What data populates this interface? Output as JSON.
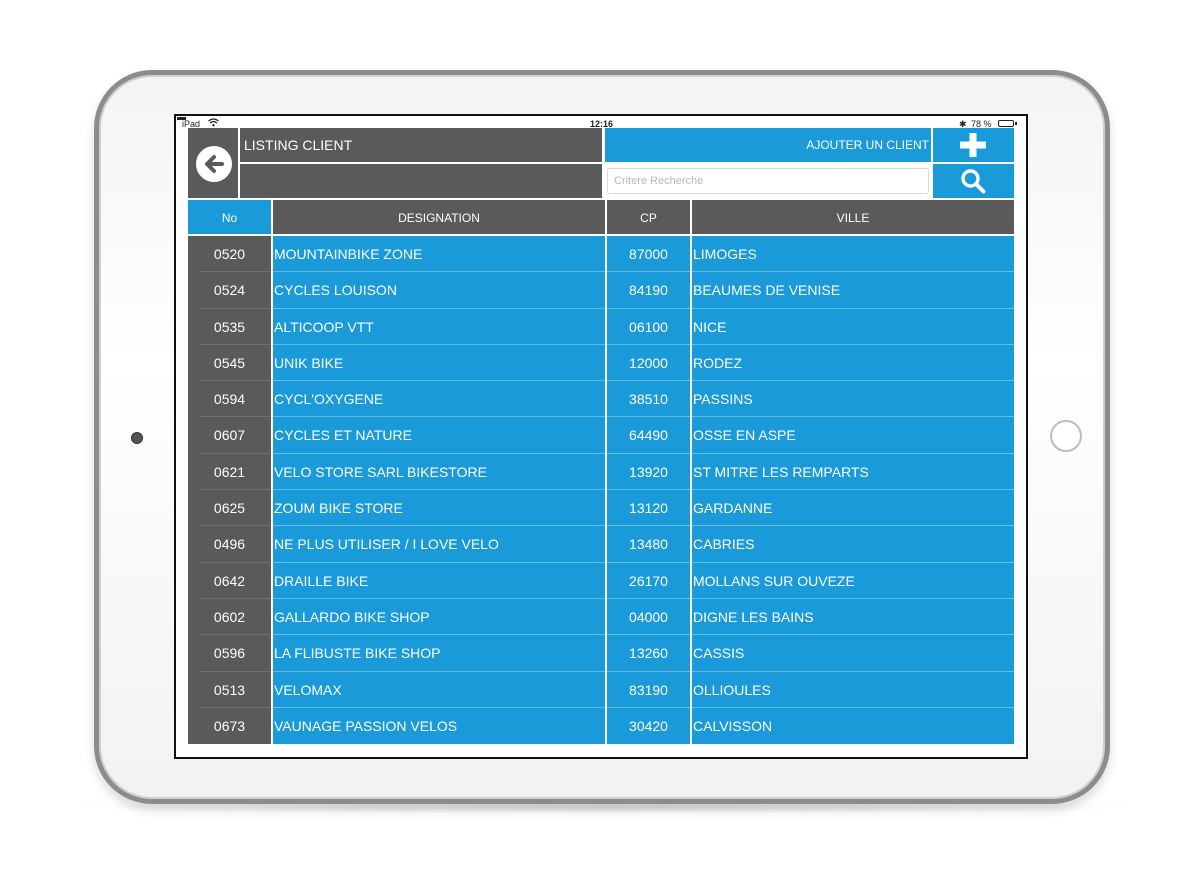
{
  "device": {
    "name": "iPad",
    "time": "12:16",
    "battery_text": "78 %",
    "battery_level": 0.78
  },
  "header": {
    "title": "LISTING CLIENT",
    "subtitle": "",
    "add_client_label": "AJOUTER UN CLIENT",
    "search_placeholder": "Critere Recherche",
    "search_value": ""
  },
  "icons": {
    "back": "arrow-left-circle-icon",
    "add": "plus-icon",
    "search": "magnifier-icon"
  },
  "colors": {
    "dark": "#5a5a5a",
    "accent": "#1a9ad8",
    "text_on_color": "#ffffff"
  },
  "table": {
    "columns": [
      "No",
      "DESIGNATION",
      "CP",
      "VILLE"
    ],
    "rows": [
      [
        "0520",
        "MOUNTAINBIKE ZONE",
        "87000",
        "LIMOGES"
      ],
      [
        "0524",
        "CYCLES LOUISON",
        "84190",
        "BEAUMES DE VENISE"
      ],
      [
        "0535",
        "ALTICOOP VTT",
        "06100",
        "NICE"
      ],
      [
        "0545",
        "UNIK BIKE",
        "12000",
        "RODEZ"
      ],
      [
        "0594",
        "CYCL'OXYGENE",
        "38510",
        "PASSINS"
      ],
      [
        "0607",
        "CYCLES ET NATURE",
        "64490",
        "OSSE EN ASPE"
      ],
      [
        "0621",
        "VELO STORE SARL BIKESTORE",
        "13920",
        "ST MITRE LES REMPARTS"
      ],
      [
        "0625",
        "ZOUM BIKE STORE",
        "13120",
        "GARDANNE"
      ],
      [
        "0496",
        "NE PLUS UTILISER / I LOVE VELO",
        "13480",
        "CABRIES"
      ],
      [
        "0642",
        "DRAILLE BIKE",
        "26170",
        "MOLLANS SUR OUVEZE"
      ],
      [
        "0602",
        "GALLARDO BIKE SHOP",
        "04000",
        "DIGNE LES BAINS"
      ],
      [
        "0596",
        "LA FLIBUSTE BIKE SHOP",
        "13260",
        "CASSIS"
      ],
      [
        "0513",
        "VELOMAX",
        "83190",
        "OLLIOULES"
      ],
      [
        "0673",
        "VAUNAGE PASSION VELOS",
        "30420",
        "CALVISSON"
      ]
    ]
  }
}
